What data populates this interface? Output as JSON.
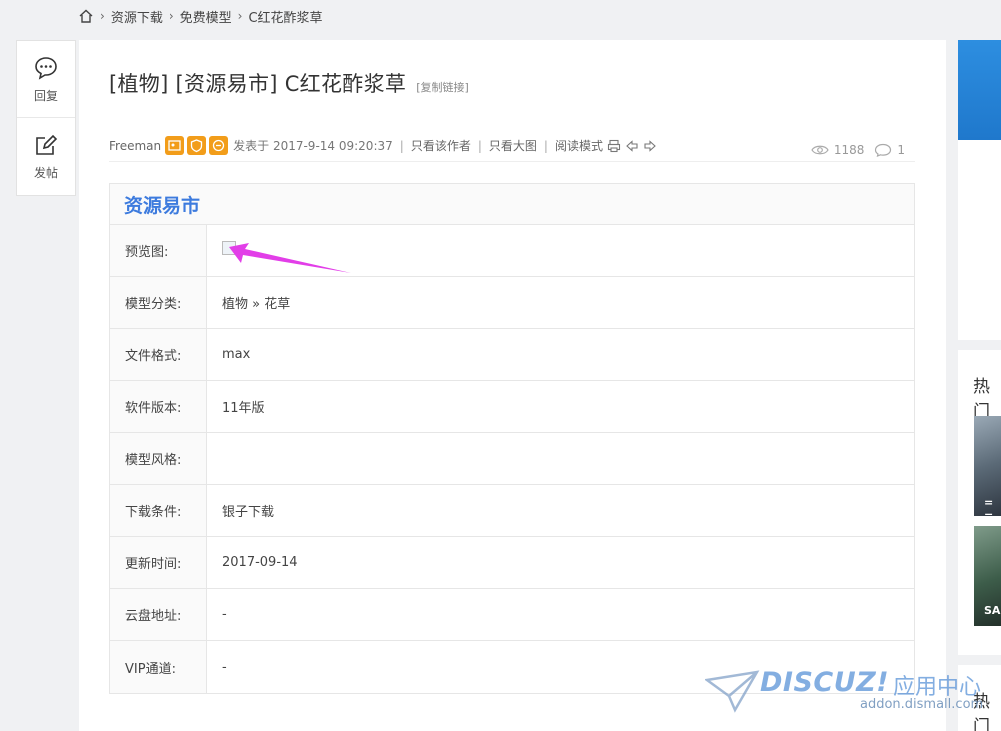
{
  "breadcrumb": {
    "items": [
      "资源下载",
      "免费模型",
      "C红花酢浆草"
    ],
    "separator": "›"
  },
  "side_actions": [
    {
      "label": "回复",
      "icon": "comment-icon"
    },
    {
      "label": "发帖",
      "icon": "edit-icon"
    }
  ],
  "thread": {
    "title": "[植物] [资源易市] C红花酢浆草",
    "copy_link": "[复制链接]",
    "author": "Freeman",
    "posted": "发表于 2017-9-14 09:20:37",
    "only_author": "只看该作者",
    "big_image": "只看大图",
    "read_mode": "阅读模式",
    "views": "1188",
    "replies": "1"
  },
  "info": {
    "header": "资源易市",
    "rows": [
      {
        "label": "预览图:",
        "value": ""
      },
      {
        "label": "模型分类:",
        "value": "植物 » 花草"
      },
      {
        "label": "文件格式:",
        "value": "max"
      },
      {
        "label": "软件版本:",
        "value": "11年版"
      },
      {
        "label": "模型风格:",
        "value": ""
      },
      {
        "label": "下载条件:",
        "value": "银子下载"
      },
      {
        "label": "更新时间:",
        "value": "2017-09-14"
      },
      {
        "label": "云盘地址:",
        "value": "-"
      },
      {
        "label": "VIP通道:",
        "value": "-"
      }
    ]
  },
  "sidebar": {
    "hot1": "热门",
    "hot2": "热门",
    "thumb1_caption": "= =",
    "thumb2_caption": "SAI"
  },
  "watermark": {
    "logo": "DISCUZ!",
    "cn": "应用中心",
    "url": "addon.dismall.com"
  },
  "colors": {
    "accent": "#3d7bde",
    "badge": "#f29d1a",
    "arrow": "#e23ee8"
  }
}
